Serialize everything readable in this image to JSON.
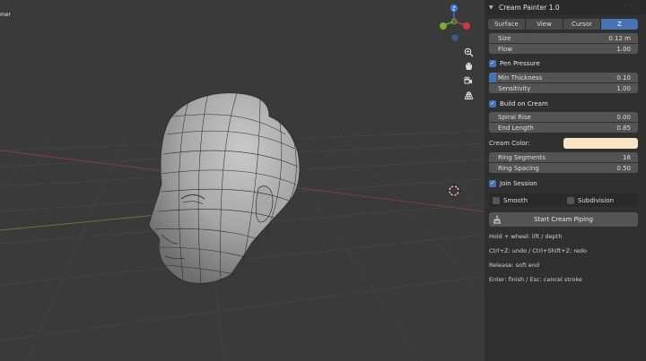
{
  "viewport": {
    "corner_label": "mer",
    "gizmo": {
      "z": "Z",
      "y": "",
      "x": ""
    },
    "nav_icons": [
      "zoom-icon",
      "hand-icon",
      "camera-icon",
      "grid-icon"
    ]
  },
  "panel": {
    "title": "Cream Painter 1.0",
    "tabs": [
      {
        "label": "Surface",
        "active": false
      },
      {
        "label": "View",
        "active": false
      },
      {
        "label": "Cursor",
        "active": false
      },
      {
        "label": "Z",
        "active": true
      }
    ],
    "size": {
      "label": "Size",
      "value": "0.12 m"
    },
    "flow": {
      "label": "Flow",
      "value": "1.00"
    },
    "pen_pressure": {
      "label": "Pen Pressure",
      "checked": true
    },
    "min_thickness": {
      "label": "Min Thickness",
      "value": "0.10",
      "fraction": 0.1
    },
    "sensitivity": {
      "label": "Sensitivity",
      "value": "1.00"
    },
    "build_on_cream": {
      "label": "Build on Cream",
      "checked": true
    },
    "spiral_rise": {
      "label": "Spiral Rise",
      "value": "0.00"
    },
    "end_length": {
      "label": "End Length",
      "value": "0.85"
    },
    "cream_color": {
      "label": "Cream Color:",
      "color": "#fde3c5"
    },
    "ring_segments": {
      "label": "Ring Segments",
      "value": "16"
    },
    "ring_spacing": {
      "label": "Ring Spacing",
      "value": "0.50"
    },
    "join_session": {
      "label": "Join Session",
      "checked": true
    },
    "smooth": {
      "label": "Smooth",
      "checked": false
    },
    "subdivision": {
      "label": "Subdivision",
      "checked": false
    },
    "start_button": {
      "label": "Start Cream Piping"
    },
    "hints": [
      "Hold + wheel: lift / depth",
      "Ctrl+Z: undo / Ctrl+Shift+Z: redo",
      "Release: soft end",
      "Enter: finish / Esc: cancel stroke"
    ]
  },
  "colors": {
    "accent": "#4772b3",
    "axis_x": "#c83c4a",
    "axis_y": "#7faa35",
    "axis_z": "#3c78c8"
  }
}
